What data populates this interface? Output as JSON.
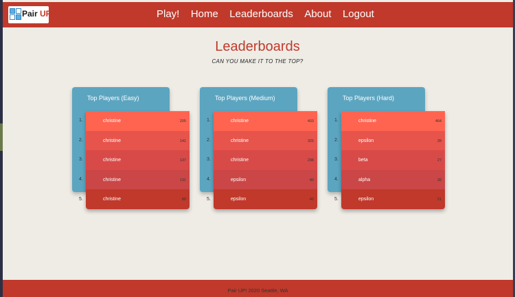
{
  "brand": {
    "name_part1": "Pair ",
    "name_part2": "UP!"
  },
  "nav": {
    "items": [
      "Play!",
      "Home",
      "Leaderboards",
      "About",
      "Logout"
    ]
  },
  "page": {
    "title": "Leaderboards",
    "subtitle": "CAN YOU MAKE IT TO THE TOP?"
  },
  "boards": [
    {
      "title": "Top Players (Easy)",
      "entries": [
        {
          "rank": "1.",
          "name": "christine",
          "score": "205"
        },
        {
          "rank": "2.",
          "name": "christine",
          "score": "141"
        },
        {
          "rank": "3.",
          "name": "christine",
          "score": "137"
        },
        {
          "rank": "4.",
          "name": "christine",
          "score": "131"
        },
        {
          "rank": "5.",
          "name": "christine",
          "score": "80"
        }
      ]
    },
    {
      "title": "Top Players (Medium)",
      "entries": [
        {
          "rank": "1.",
          "name": "christine",
          "score": "403"
        },
        {
          "rank": "2.",
          "name": "christine",
          "score": "325"
        },
        {
          "rank": "3.",
          "name": "christine",
          "score": "298"
        },
        {
          "rank": "4.",
          "name": "epsilon",
          "score": "40"
        },
        {
          "rank": "5.",
          "name": "epsilon",
          "score": "40"
        }
      ]
    },
    {
      "title": "Top Players (Hard)",
      "entries": [
        {
          "rank": "1.",
          "name": "christine",
          "score": "464"
        },
        {
          "rank": "2.",
          "name": "epsilon",
          "score": "28"
        },
        {
          "rank": "3.",
          "name": "beta",
          "score": "27"
        },
        {
          "rank": "4.",
          "name": "alpha",
          "score": "26"
        },
        {
          "rank": "5.",
          "name": "epsilon",
          "score": "21"
        }
      ]
    }
  ],
  "footer": {
    "text": "Pair UP! 2020 Seattle, WA"
  },
  "colors": {
    "brand_red": "#c0392b",
    "card_blue": "#5ca5c0",
    "background": "#efece6",
    "row_colors": [
      "#ff6450",
      "#e6544c",
      "#d84a48",
      "#cb4646",
      "#c0392b"
    ]
  }
}
